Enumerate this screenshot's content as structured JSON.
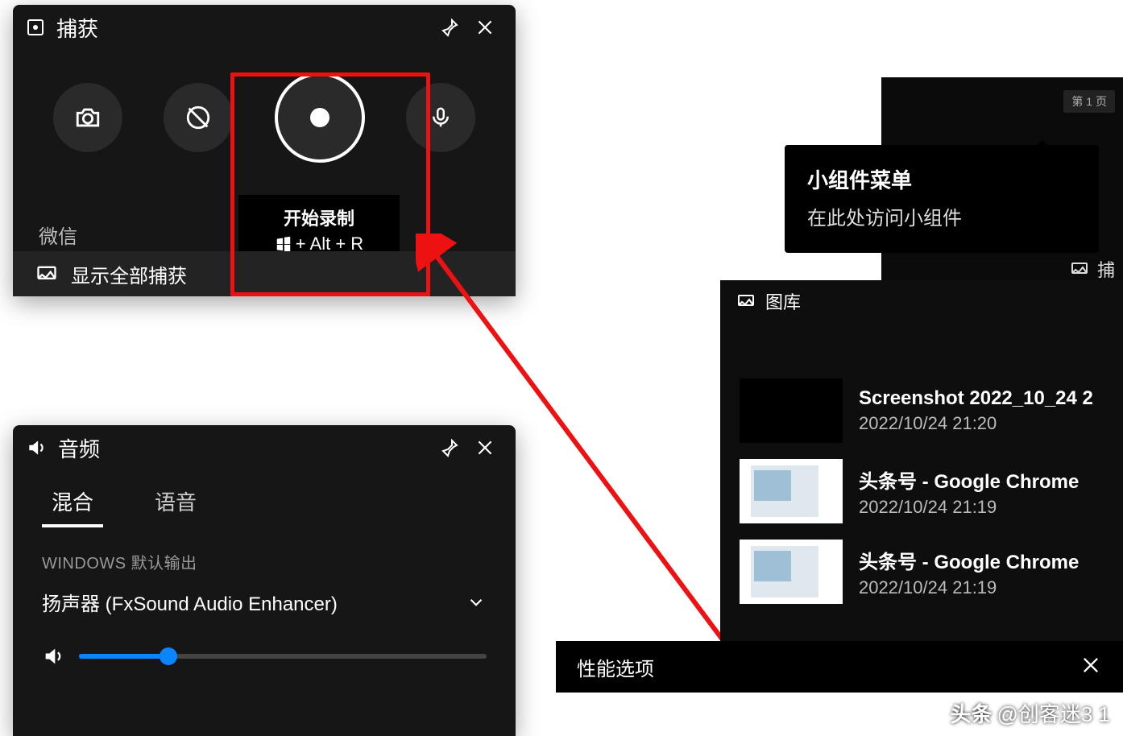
{
  "capture": {
    "title": "捕获",
    "source_app": "微信",
    "record_tip_label": "开始录制",
    "record_tip_shortcut": "+ Alt + R",
    "show_all_label": "显示全部捕获"
  },
  "audio": {
    "title": "音频",
    "tabs": {
      "mix": "混合",
      "voice": "语音"
    },
    "section_label": "WINDOWS 默认输出",
    "device_name": "扬声器 (FxSound Audio Enhancer)",
    "volume_percent": 22
  },
  "tooltip": {
    "title": "小组件菜单",
    "desc": "在此处访问小组件"
  },
  "bg_strip": {
    "tag": "第 1 页",
    "row_label": "捕"
  },
  "gallery": {
    "title": "图库",
    "items": [
      {
        "name": "Screenshot 2022_10_24 2",
        "date": "2022/10/24 21:20",
        "thumb": "dark"
      },
      {
        "name": "头条号 - Google Chrome",
        "date": "2022/10/24 21:19",
        "thumb": "light"
      },
      {
        "name": "头条号 - Google Chrome",
        "date": "2022/10/24 21:19",
        "thumb": "light"
      }
    ]
  },
  "perf": {
    "title": "性能选项"
  },
  "watermark": {
    "brand": "头条",
    "at": "@创客迷3 1"
  }
}
